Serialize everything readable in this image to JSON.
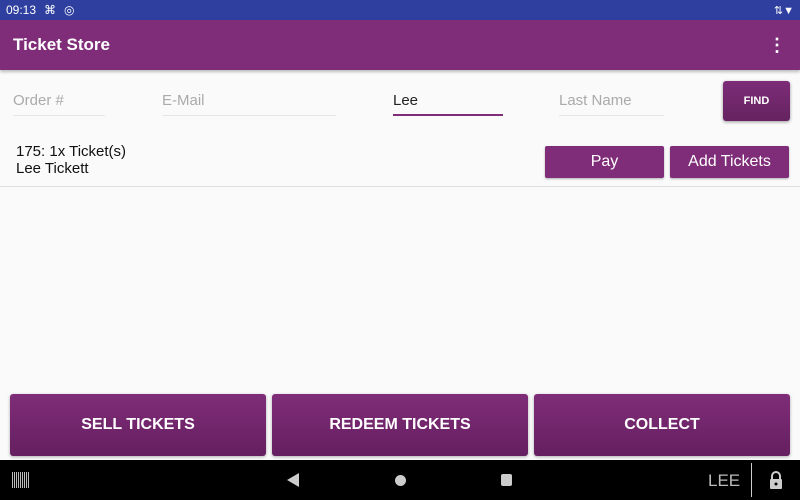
{
  "status_bar": {
    "time": "09:13"
  },
  "app_bar": {
    "title": "Ticket Store",
    "menu_icon": "more-vert-icon"
  },
  "search": {
    "order_placeholder": "Order #",
    "email_placeholder": "E-Mail",
    "first_name_value": "Lee",
    "last_name_placeholder": "Last Name",
    "find_label": "FIND"
  },
  "results": [
    {
      "line1": "175: 1x Ticket(s)",
      "line2": "Lee Tickett",
      "pay_label": "Pay",
      "add_label": "Add Tickets"
    }
  ],
  "actions": {
    "sell": "SELL TICKETS",
    "redeem": "REDEEM TICKETS",
    "collect": "COLLECT"
  },
  "nav_bar": {
    "user": "LEE"
  },
  "colors": {
    "primary": "#7f2d78",
    "status_bar": "#2e3f9f"
  }
}
